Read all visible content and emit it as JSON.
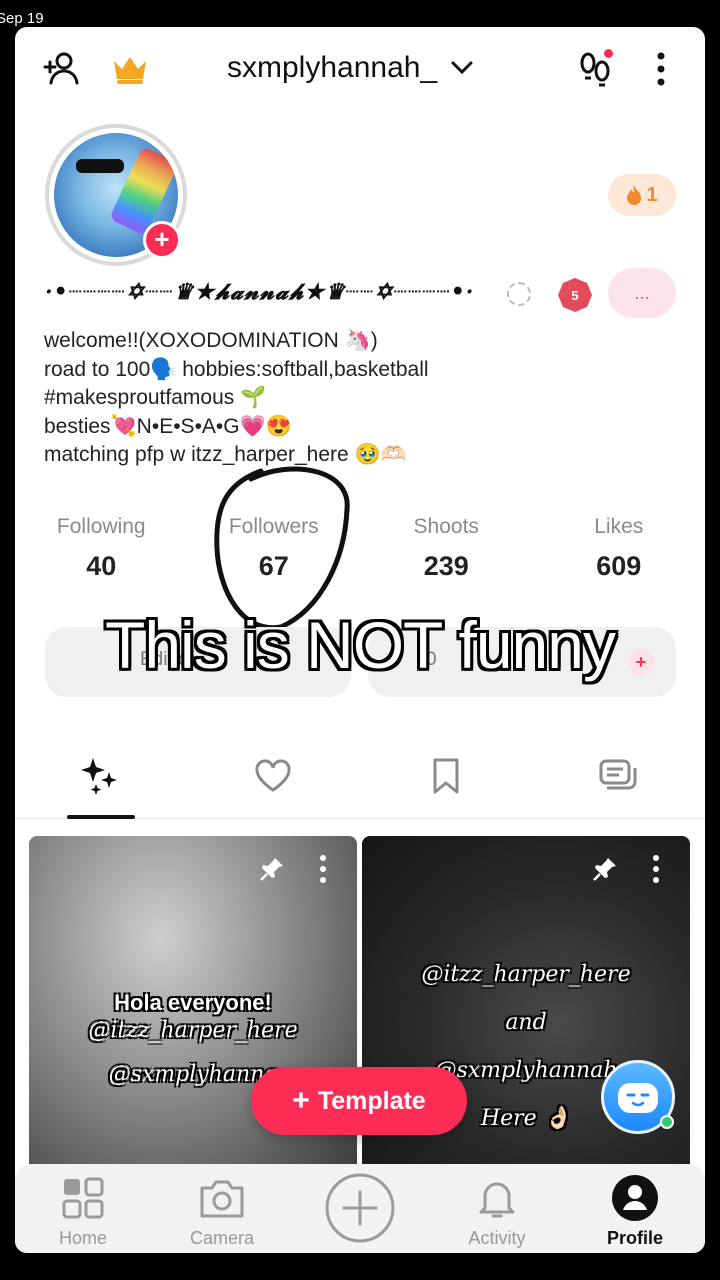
{
  "status": {
    "date": "Sep 19"
  },
  "header": {
    "username": "sxmplyhannah_"
  },
  "profile": {
    "fire_count": "1",
    "display_name": "·•┈┈┈┈✡┈┈♛★𝓱𝓪𝓷𝓷𝓪𝓱★♛┈┈✡┈┈┈┈•·",
    "level": "5",
    "more_label": "...",
    "bio_lines": [
      "welcome!!(XOXODOMINATION 🦄)",
      "road to 100🗣️ hobbies:softball,basketball",
      "#makesproutfamous 🌱",
      "besties💘N•E•S•A•G💗😍",
      "matching pfp w itzz_harper_here 🥹🫶🏻"
    ]
  },
  "stats": [
    {
      "label": "Following",
      "value": "40"
    },
    {
      "label": "Followers",
      "value": "67"
    },
    {
      "label": "Shoots",
      "value": "239"
    },
    {
      "label": "Likes",
      "value": "609"
    }
  ],
  "overlay_caption": "This is NOT funny",
  "pills": {
    "left_faint": "Edit of",
    "right_faint": "0"
  },
  "grid": [
    {
      "lines": [
        "Hola everyone!",
        "@itzz_harper_here",
        "@sxmplyhanna"
      ]
    },
    {
      "lines": [
        "@itzz_harper_here",
        "and",
        "@sxmplyhannah",
        "Here 👌🏻"
      ]
    }
  ],
  "template_button": {
    "label": "Template"
  },
  "bottom_nav": [
    {
      "label": "Home"
    },
    {
      "label": "Camera"
    },
    {
      "label": ""
    },
    {
      "label": "Activity"
    },
    {
      "label": "Profile"
    }
  ],
  "colors": {
    "accent": "#ff2d55",
    "fire": "#f08a2c",
    "muted": "#8a8a8a"
  }
}
